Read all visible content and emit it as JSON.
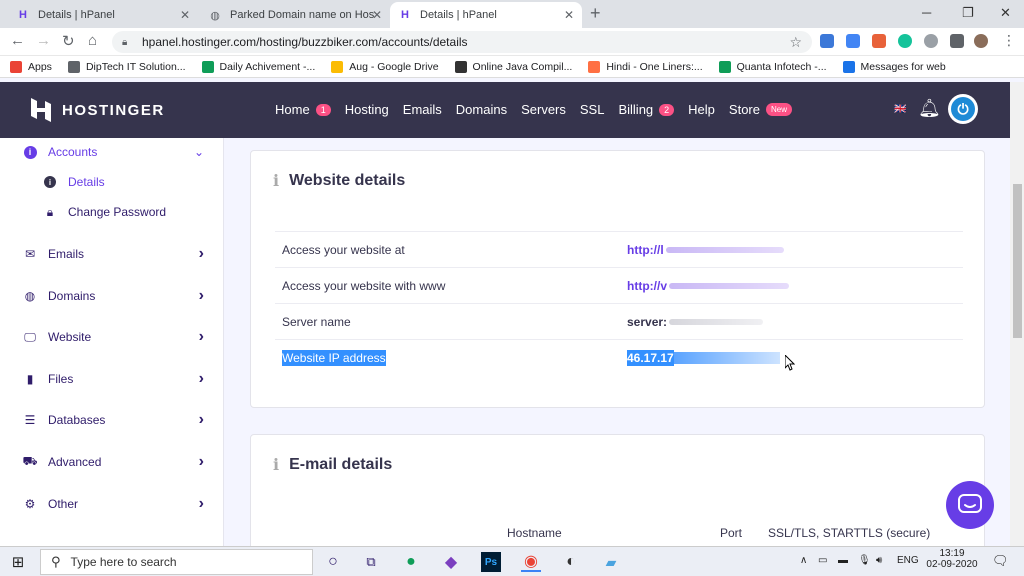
{
  "browser": {
    "tabs": [
      {
        "title": "Details | hPanel",
        "active": false
      },
      {
        "title": "Parked Domain name on Hosting",
        "active": false
      },
      {
        "title": "Details | hPanel",
        "active": true
      }
    ],
    "url": "hpanel.hostinger.com/hosting/buzzbiker.com/accounts/details",
    "bookmarks": [
      {
        "label": "Apps",
        "icon": "apps-grid-icon",
        "color": "#ea4335"
      },
      {
        "label": "DipTech IT Solution...",
        "icon": "globe-icon",
        "color": "#5f6368"
      },
      {
        "label": "Daily Achivement -...",
        "icon": "sheets-icon",
        "color": "#0f9d58"
      },
      {
        "label": "Aug - Google Drive",
        "icon": "drive-icon",
        "color": "#fbbc04"
      },
      {
        "label": "Online Java Compil...",
        "icon": "java-icon",
        "color": "#333333"
      },
      {
        "label": "Hindi - One Liners:...",
        "icon": "rainbow-icon",
        "color": "#ff7043"
      },
      {
        "label": "Quanta Infotech -...",
        "icon": "sheets-icon",
        "color": "#0f9d58"
      },
      {
        "label": "Messages for web",
        "icon": "messages-icon",
        "color": "#1a73e8"
      }
    ]
  },
  "header": {
    "brand": "HOSTINGER",
    "nav": [
      {
        "label": "Home",
        "badge": "1"
      },
      {
        "label": "Hosting",
        "badge": ""
      },
      {
        "label": "Emails",
        "badge": ""
      },
      {
        "label": "Domains",
        "badge": ""
      },
      {
        "label": "Servers",
        "badge": ""
      },
      {
        "label": "SSL",
        "badge": ""
      },
      {
        "label": "Billing",
        "badge": "2"
      },
      {
        "label": "Help",
        "badge": ""
      },
      {
        "label": "Store",
        "badge": "New"
      }
    ],
    "colors": {
      "bg": "#36344d",
      "badge": "#fc5185",
      "accent": "#673de6"
    }
  },
  "sidebar": {
    "accounts": "Accounts",
    "details": "Details",
    "change_password": "Change Password",
    "items": [
      {
        "label": "Emails",
        "icon": "envelope-icon"
      },
      {
        "label": "Domains",
        "icon": "globe-icon"
      },
      {
        "label": "Website",
        "icon": "monitor-icon"
      },
      {
        "label": "Files",
        "icon": "file-icon"
      },
      {
        "label": "Databases",
        "icon": "database-icon"
      },
      {
        "label": "Advanced",
        "icon": "car-icon"
      },
      {
        "label": "Other",
        "icon": "gears-icon"
      }
    ]
  },
  "website_details": {
    "title": "Website details",
    "rows": [
      {
        "label": "Access your website at",
        "value": "http://l"
      },
      {
        "label": "Access your website with www",
        "value": "http://v"
      },
      {
        "label": "Server name",
        "value": "server:"
      },
      {
        "label": "Website IP address",
        "value": "46.17.17"
      }
    ]
  },
  "email_details": {
    "title": "E-mail details",
    "columns": [
      "Hostname",
      "Port",
      "SSL/TLS, STARTTLS (secure)"
    ]
  },
  "taskbar": {
    "search_placeholder": "Type here to search",
    "language": "ENG",
    "time": "13:19",
    "date": "02-09-2020"
  }
}
